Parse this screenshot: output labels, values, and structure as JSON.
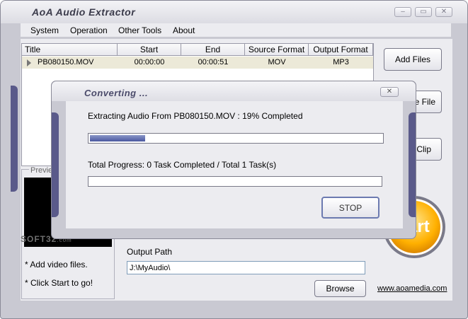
{
  "window": {
    "title": "AoA Audio Extractor"
  },
  "menu": [
    "System",
    "Operation",
    "Other Tools",
    "About"
  ],
  "table": {
    "columns": [
      "Title",
      "Start",
      "End",
      "Source Format",
      "Output Format"
    ],
    "rows": [
      {
        "title": "PB080150.MOV",
        "start": "00:00:00",
        "end": "00:00:51",
        "source": "MOV",
        "output": "MP3"
      }
    ]
  },
  "buttons": {
    "add_files": "Add Files",
    "remove_file_partial": "e File",
    "clip_partial": "Clip",
    "browse": "Browse",
    "start_partial": "art"
  },
  "preview": {
    "label": "Previe",
    "watermark": "SOFT32",
    "watermark_suffix": ".com",
    "hints": [
      "* Add video files.",
      "* Click Start to go!"
    ]
  },
  "output": {
    "label": "Output Path",
    "value": "J:\\MyAudio\\"
  },
  "link": "www.aoamedia.com",
  "dialog": {
    "title": "Converting ...",
    "status_text": "Extracting Audio From  PB080150.MOV  :  19% Completed",
    "file_progress": 0.19,
    "total_text": "Total Progress: 0 Task Completed / Total 1 Task(s)",
    "total_progress": 0.0,
    "stop": "STOP"
  },
  "colors": {
    "accent": "#5a5a8a",
    "progress": "#4a58a0",
    "start": "#ffb000"
  }
}
